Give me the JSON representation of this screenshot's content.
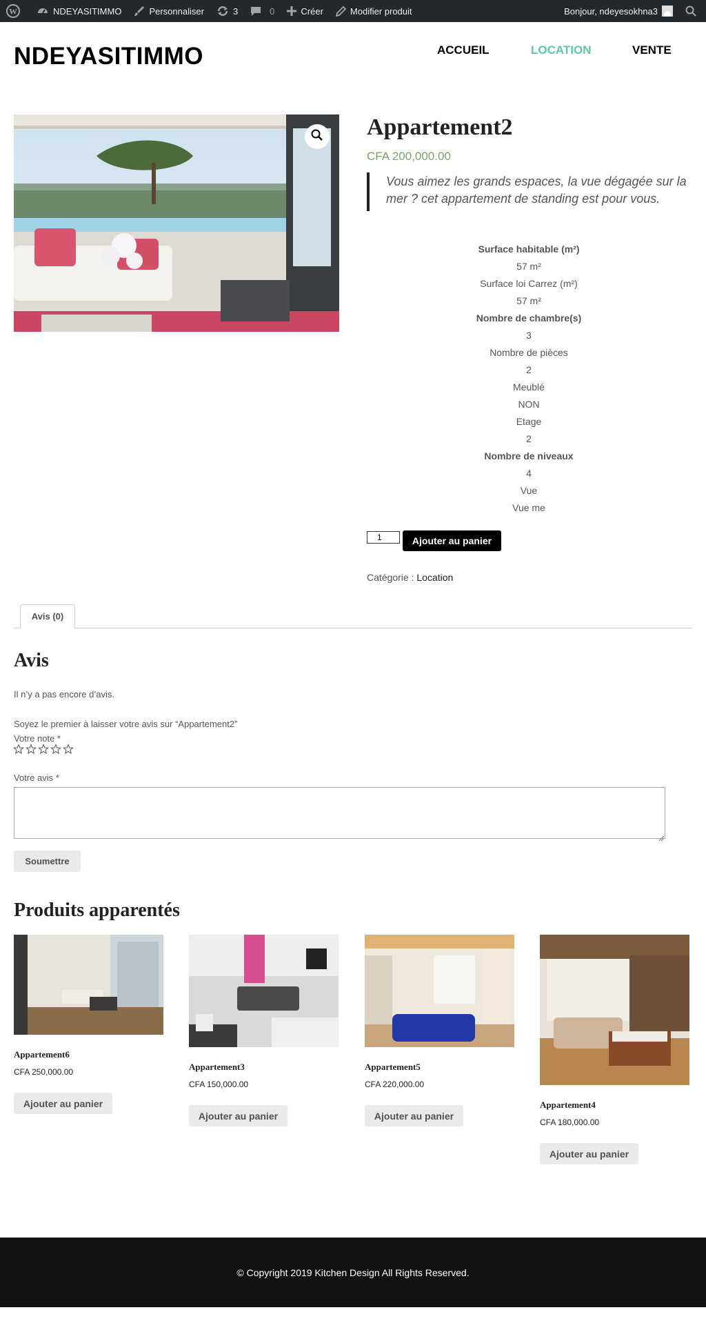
{
  "admin_bar": {
    "items": [
      {
        "icon": "wordpress-icon",
        "label": ""
      },
      {
        "icon": "dashboard-icon",
        "label": "NDEYASITIMMO"
      },
      {
        "icon": "brush-icon",
        "label": "Personnaliser"
      },
      {
        "icon": "updates-icon",
        "label": "3"
      },
      {
        "icon": "comment-icon",
        "label": "0"
      },
      {
        "icon": "plus-icon",
        "label": "Créer"
      },
      {
        "icon": "pencil-icon",
        "label": "Modifier produit"
      }
    ],
    "greeting": "Bonjour, ndeyesokhna3",
    "search_icon": "search-icon"
  },
  "header": {
    "site_title": "NDEYASITIMMO",
    "nav": [
      "ACCUEIL",
      "LOCATION",
      "VENTE"
    ],
    "active_nav": "LOCATION"
  },
  "product": {
    "title": "Appartement2",
    "price": "CFA 200,000.00",
    "description": "Vous aimez les grands espaces, la vue dégagée sur la mer ? cet appartement de standing est pour vous.",
    "attributes": [
      "Surface habitable (m²)",
      "57 m²",
      "Surface loi Carrez (m²)",
      "57 m²",
      "Nombre de chambre(s)",
      "3",
      "Nombre de pièces",
      "2",
      "Meublé",
      "NON",
      "Etage",
      "2",
      "Nombre de niveaux",
      "4",
      "Vue",
      "Vue me"
    ],
    "bold_attributes": [
      "Surface habitable (m²)",
      "Nombre de chambre(s)",
      "Nombre de niveaux"
    ],
    "quantity": "1",
    "add_to_cart": "Ajouter au panier",
    "category_label": "Catégorie :",
    "category": "Location"
  },
  "tabs": [
    "Avis (0)"
  ],
  "reviews": {
    "title": "Avis",
    "none": "Il n’y a pas encore d’avis.",
    "be_first": "Soyez le premier à laisser votre avis sur “Appartement2”",
    "rating_label": "Votre note *",
    "review_label": "Votre avis *",
    "submit": "Soumettre"
  },
  "related": {
    "title": "Produits apparentés",
    "items": [
      {
        "name": "Appartement6",
        "price": "CFA 250,000.00",
        "button": "Ajouter au panier"
      },
      {
        "name": "Appartement3",
        "price": "CFA 150,000.00",
        "button": "Ajouter au panier"
      },
      {
        "name": "Appartement5",
        "price": "CFA 220,000.00",
        "button": "Ajouter au panier"
      },
      {
        "name": "Appartement4",
        "price": "CFA 180,000.00",
        "button": "Ajouter au panier"
      }
    ]
  },
  "footer": {
    "copyright": "© Copyright 2019 Kitchen Design All Rights Reserved."
  }
}
